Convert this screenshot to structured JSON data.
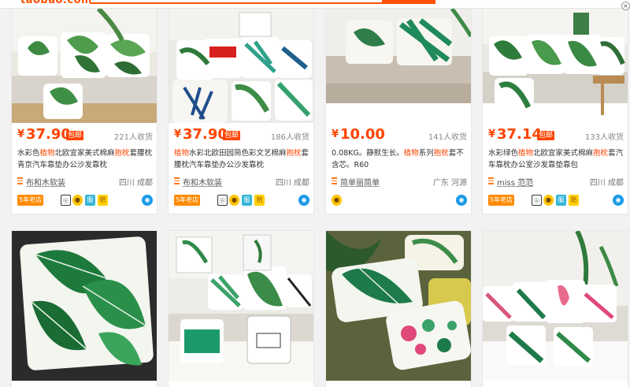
{
  "header": {
    "logo_text": "taobao.com",
    "close_label": "×"
  },
  "products": [
    {
      "price_symbol": "¥",
      "price": "37.90",
      "shipping_tag": "包邮",
      "sales": "221人收货",
      "title_parts": [
        "水彩色",
        "植物",
        "北欧宜家美式棉麻",
        "抱枕",
        "套腰枕青京汽车靠垫办公沙发靠枕"
      ],
      "shop": "布和木软装",
      "location": "四川 成都",
      "year_badge": "5年老店",
      "icons": [
        "gold-medal",
        "暖",
        "服",
        "赔"
      ]
    },
    {
      "price_symbol": "¥",
      "price": "37.90",
      "shipping_tag": "包邮",
      "sales": "186人收货",
      "title_parts": [
        "",
        "植物",
        "水彩北欧田园简色彩文艺棉麻",
        "抱枕",
        "套腰枕汽车靠垫办公沙发靠枕"
      ],
      "shop": "布和木软装",
      "location": "四川 成都",
      "year_badge": "5年老店",
      "icons": [
        "gold-medal",
        "暖",
        "服",
        "赔"
      ]
    },
    {
      "price_symbol": "¥",
      "price": "10.00",
      "shipping_tag": "",
      "sales": "141人收货",
      "title_parts": [
        "0.08KG。静默生长。",
        "植物",
        "系列",
        "抱枕",
        "套不含芯。R60"
      ],
      "shop": "简单丽简单",
      "location": "广东 河源",
      "year_badge": "",
      "icons": [
        "gold-medal"
      ]
    },
    {
      "price_symbol": "¥",
      "price": "37.14",
      "shipping_tag": "包邮",
      "sales": "133人收货",
      "title_parts": [
        "水彩绿色",
        "植物",
        "北欧宜家美式棉麻",
        "抱枕",
        "套汽车靠枕办公室沙发靠垫靠包"
      ],
      "shop": "miss 范范",
      "location": "四川 成都",
      "year_badge": "5年老店",
      "icons": [
        "gold-medal",
        "暖",
        "服",
        "赔"
      ]
    }
  ],
  "colors": {
    "accent": "#ff4400",
    "brand": "#ff5000"
  }
}
